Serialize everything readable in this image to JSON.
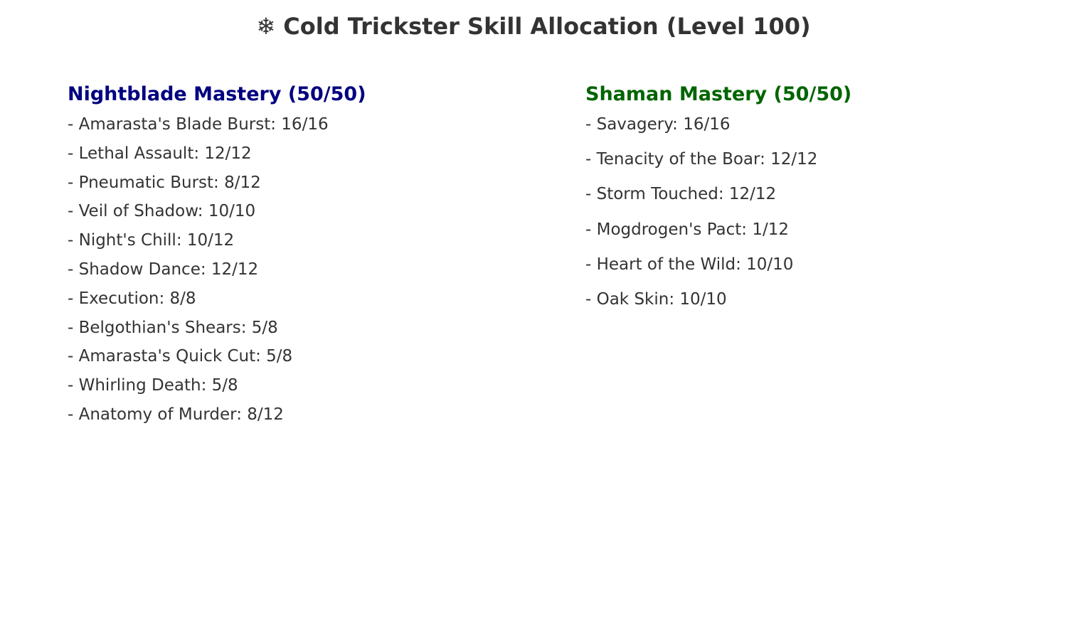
{
  "title": "❄ Cold Trickster Skill Allocation (Level 100)",
  "colors": {
    "text": "#333333",
    "nightblade_heading": "#000080",
    "shaman_heading": "#006400"
  },
  "nightblade": {
    "heading": "Nightblade Mastery (50/50)",
    "skills": [
      "- Amarasta's Blade Burst: 16/16",
      "- Lethal Assault: 12/12",
      "- Pneumatic Burst: 8/12",
      "- Veil of Shadow: 10/10",
      "- Night's Chill: 10/12",
      "- Shadow Dance: 12/12",
      "- Execution: 8/8",
      "- Belgothian's Shears: 5/8",
      "- Amarasta's Quick Cut: 5/8",
      "- Whirling Death: 5/8",
      "- Anatomy of Murder: 8/12"
    ]
  },
  "shaman": {
    "heading": "Shaman Mastery (50/50)",
    "skills": [
      "- Savagery: 16/16",
      "- Tenacity of the Boar: 12/12",
      "- Storm Touched: 12/12",
      "- Mogdrogen's Pact: 1/12",
      "- Heart of the Wild: 10/10",
      "- Oak Skin: 10/10"
    ]
  }
}
